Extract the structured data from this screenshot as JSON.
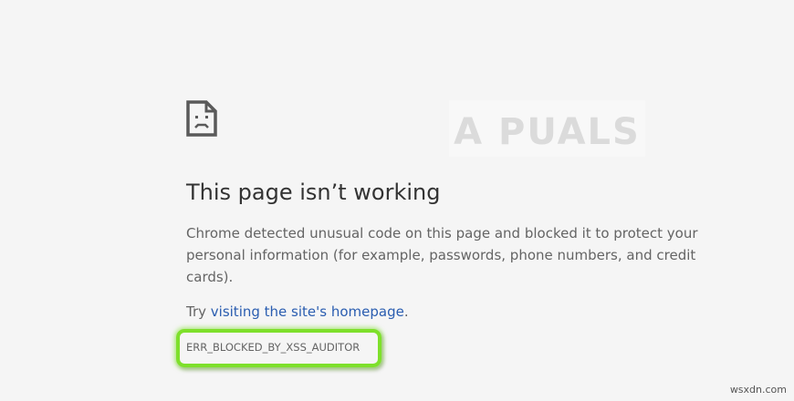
{
  "page": {
    "title": "This page isn’t working",
    "description": "Chrome detected unusual code on this page and blocked it to protect your personal information (for example, passwords, phone numbers, and credit cards).",
    "suggestion_prefix": "Try ",
    "suggestion_link": "visiting the site's homepage",
    "suggestion_suffix": ".",
    "error_code": "ERR_BLOCKED_BY_XSS_AUDITOR"
  },
  "watermark": {
    "text": "A PUALS"
  },
  "footer": {
    "text": "wsxdn.com"
  },
  "colors": {
    "background": "#f5f5f5",
    "link": "#2a5db0",
    "highlight": "#7ee02b"
  }
}
